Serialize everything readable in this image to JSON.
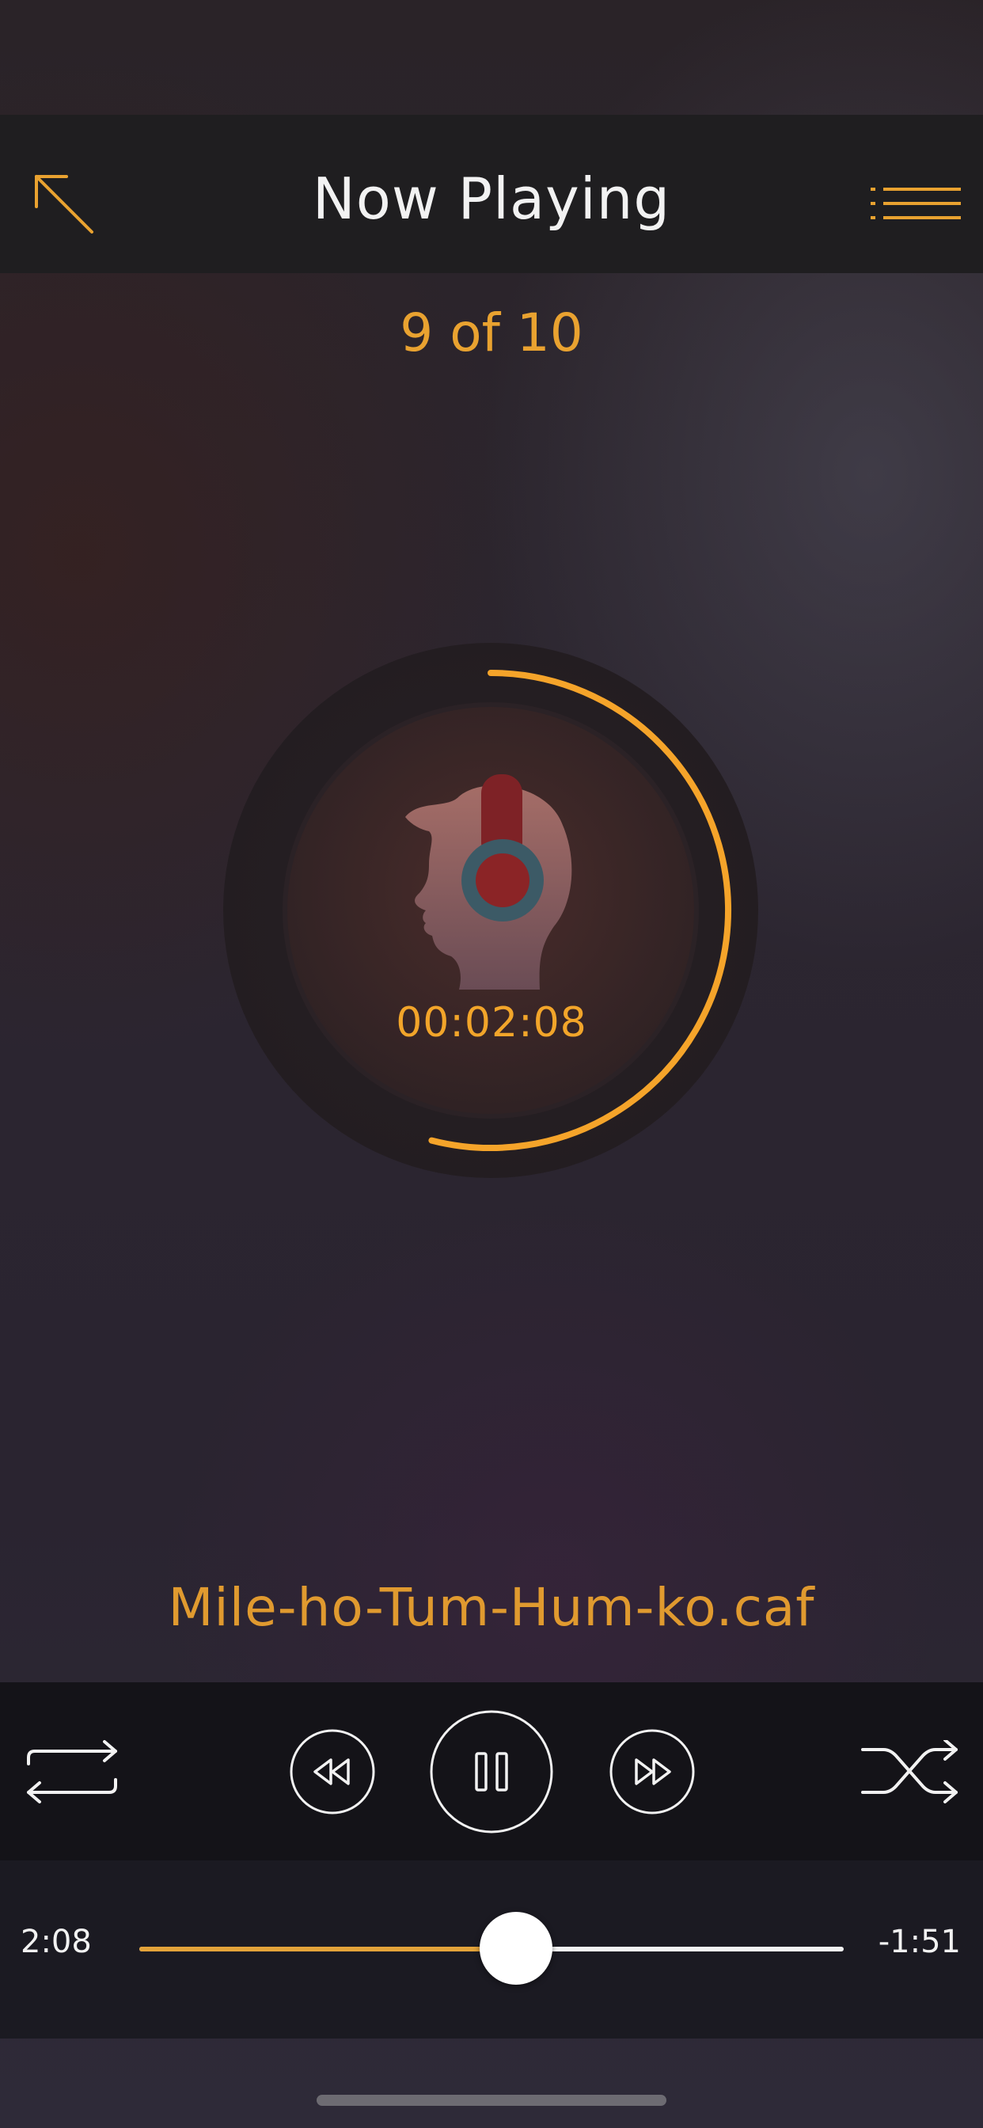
{
  "header": {
    "title": "Now Playing",
    "back_icon": "arrow-up-left-icon",
    "queue_icon": "list-icon"
  },
  "track_position": "9 of 10",
  "now_playing": {
    "elapsed_display": "00:02:08",
    "track_name": "Mile-ho-Tum-Hum-ko.caf",
    "artwork_icon": "headphones-head-icon",
    "ring_progress": 0.54
  },
  "controls": {
    "repeat_icon": "repeat-icon",
    "rewind_icon": "rewind-icon",
    "pause_icon": "pause-icon",
    "fast_forward_icon": "fast-forward-icon",
    "shuffle_icon": "shuffle-icon"
  },
  "progress": {
    "elapsed": "2:08",
    "remaining": "-1:51",
    "fraction": 0.535
  },
  "colors": {
    "accent": "#e9a230",
    "header_bg": "#1f1e20",
    "controls_bg": "#141318"
  }
}
